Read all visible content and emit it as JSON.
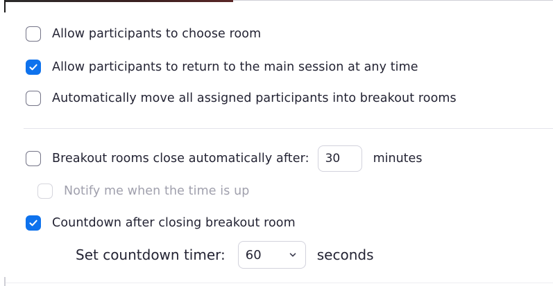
{
  "options": {
    "choose_room": {
      "label": "Allow participants to choose room",
      "checked": false
    },
    "return_main": {
      "label": "Allow participants to return to the main session at any time",
      "checked": true
    },
    "auto_move": {
      "label": "Automatically move all assigned participants into breakout rooms",
      "checked": false
    },
    "auto_close": {
      "label": "Breakout rooms close automatically after:",
      "checked": false,
      "minutes_value": "30",
      "minutes_unit": "minutes"
    },
    "notify": {
      "label": "Notify me when the time is up",
      "checked": false,
      "disabled": true
    },
    "countdown": {
      "label": "Countdown after closing breakout room",
      "checked": true
    }
  },
  "countdown_timer": {
    "label": "Set countdown timer:",
    "selected": "60",
    "unit": "seconds"
  },
  "colors": {
    "accent": "#0e72ed",
    "text": "#232333",
    "disabled_text": "#a0a0ad"
  },
  "icons": {
    "check": "checkmark-icon",
    "dropdown": "chevron-down-icon"
  }
}
